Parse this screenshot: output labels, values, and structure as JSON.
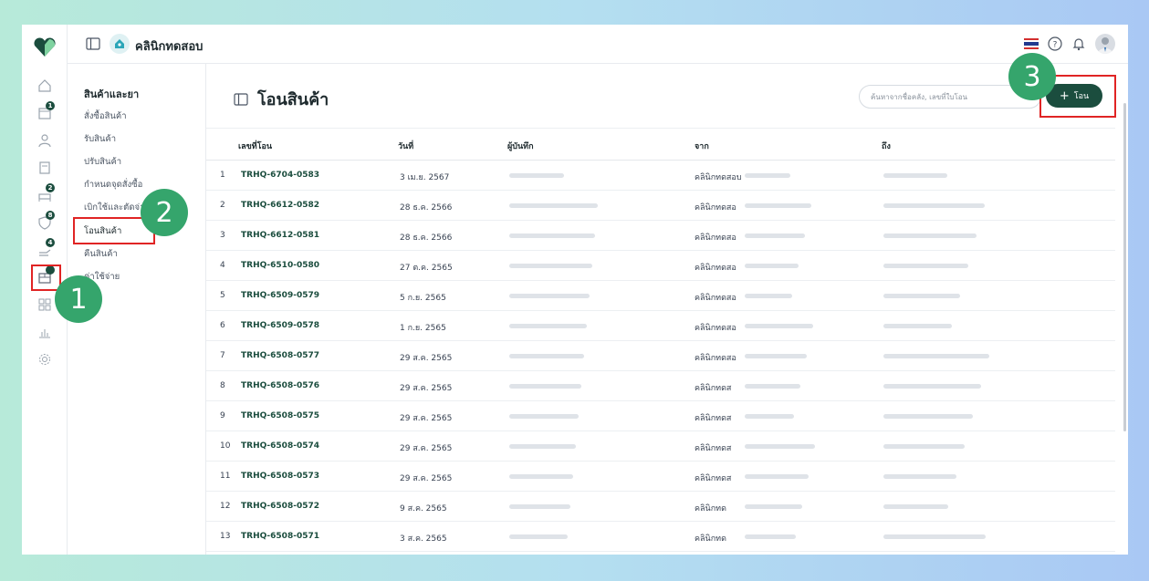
{
  "topbar": {
    "clinic_name": "คลินิกทดสอบ"
  },
  "rail": {
    "badges": [
      "1",
      "2",
      "8",
      "4",
      ""
    ]
  },
  "subnav": {
    "title": "สินค้าและยา",
    "items": [
      "สั่งซื้อสินค้า",
      "รับสินค้า",
      "ปรับสินค้า",
      "กำหนดจุดสั่งซื้อ",
      "เบิกใช้และตัดจ่าย",
      "โอนสินค้า",
      "คืนสินค้า",
      "ค่าใช้จ่าย"
    ]
  },
  "main": {
    "title": "โอนสินค้า",
    "search_placeholder": "ค้นหาจากชื่อคลัง, เลขที่ใบโอน",
    "add_label": "โอน"
  },
  "table": {
    "headers": [
      "เลขที่โอน",
      "วันที่",
      "ผู้บันทึก",
      "จาก",
      "ถึง"
    ],
    "rows": [
      {
        "no": "1",
        "code": "TRHQ-6704-0583",
        "date": "3 เม.ย. 2567",
        "from": "คลินิกทดสอบ"
      },
      {
        "no": "2",
        "code": "TRHQ-6612-0582",
        "date": "28 ธ.ค. 2566",
        "from": "คลินิกทดสอ"
      },
      {
        "no": "3",
        "code": "TRHQ-6612-0581",
        "date": "28 ธ.ค. 2566",
        "from": "คลินิกทดสอ"
      },
      {
        "no": "4",
        "code": "TRHQ-6510-0580",
        "date": "27 ต.ค. 2565",
        "from": "คลินิกทดสอ"
      },
      {
        "no": "5",
        "code": "TRHQ-6509-0579",
        "date": "5 ก.ย. 2565",
        "from": "คลินิกทดสอ"
      },
      {
        "no": "6",
        "code": "TRHQ-6509-0578",
        "date": "1 ก.ย. 2565",
        "from": "คลินิกทดสอ"
      },
      {
        "no": "7",
        "code": "TRHQ-6508-0577",
        "date": "29 ส.ค. 2565",
        "from": "คลินิกทดสอ"
      },
      {
        "no": "8",
        "code": "TRHQ-6508-0576",
        "date": "29 ส.ค. 2565",
        "from": "คลินิกทดส"
      },
      {
        "no": "9",
        "code": "TRHQ-6508-0575",
        "date": "29 ส.ค. 2565",
        "from": "คลินิกทดส"
      },
      {
        "no": "10",
        "code": "TRHQ-6508-0574",
        "date": "29 ส.ค. 2565",
        "from": "คลินิกทดส"
      },
      {
        "no": "11",
        "code": "TRHQ-6508-0573",
        "date": "29 ส.ค. 2565",
        "from": "คลินิกทดส"
      },
      {
        "no": "12",
        "code": "TRHQ-6508-0572",
        "date": "9 ส.ค. 2565",
        "from": "คลินิกทด"
      },
      {
        "no": "13",
        "code": "TRHQ-6508-0571",
        "date": "3 ส.ค. 2565",
        "from": "คลินิกทด"
      }
    ]
  },
  "annotations": {
    "step1": "1",
    "step2": "2",
    "step3": "3"
  },
  "colors": {
    "accent": "#1b4d3e",
    "step": "#35a56c",
    "highlight": "#e02424"
  }
}
